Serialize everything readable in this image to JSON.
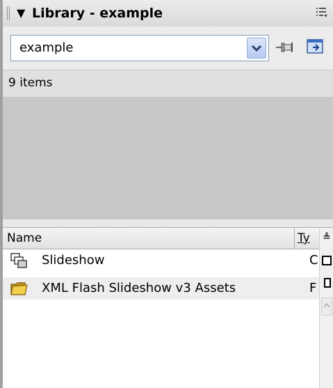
{
  "panel": {
    "title": "Library - example",
    "collapse_glyph": "▼"
  },
  "library_select": {
    "value": "example"
  },
  "status": {
    "item_count": "9 items"
  },
  "list": {
    "columns": {
      "name": "Name",
      "type": "Ty"
    },
    "sort_glyph": "≜",
    "rows": [
      {
        "name": "Slideshow",
        "type": "C",
        "icon": "movieclip-icon"
      },
      {
        "name": "XML Flash Slideshow v3 Assets",
        "type": "F",
        "icon": "folder-icon"
      }
    ]
  },
  "colors": {
    "panel_bg": "#d7d7d7",
    "preview_bg": "#c8c8c8",
    "select_border": "#7f9db9",
    "folder_yellow": "#e8c23a"
  }
}
